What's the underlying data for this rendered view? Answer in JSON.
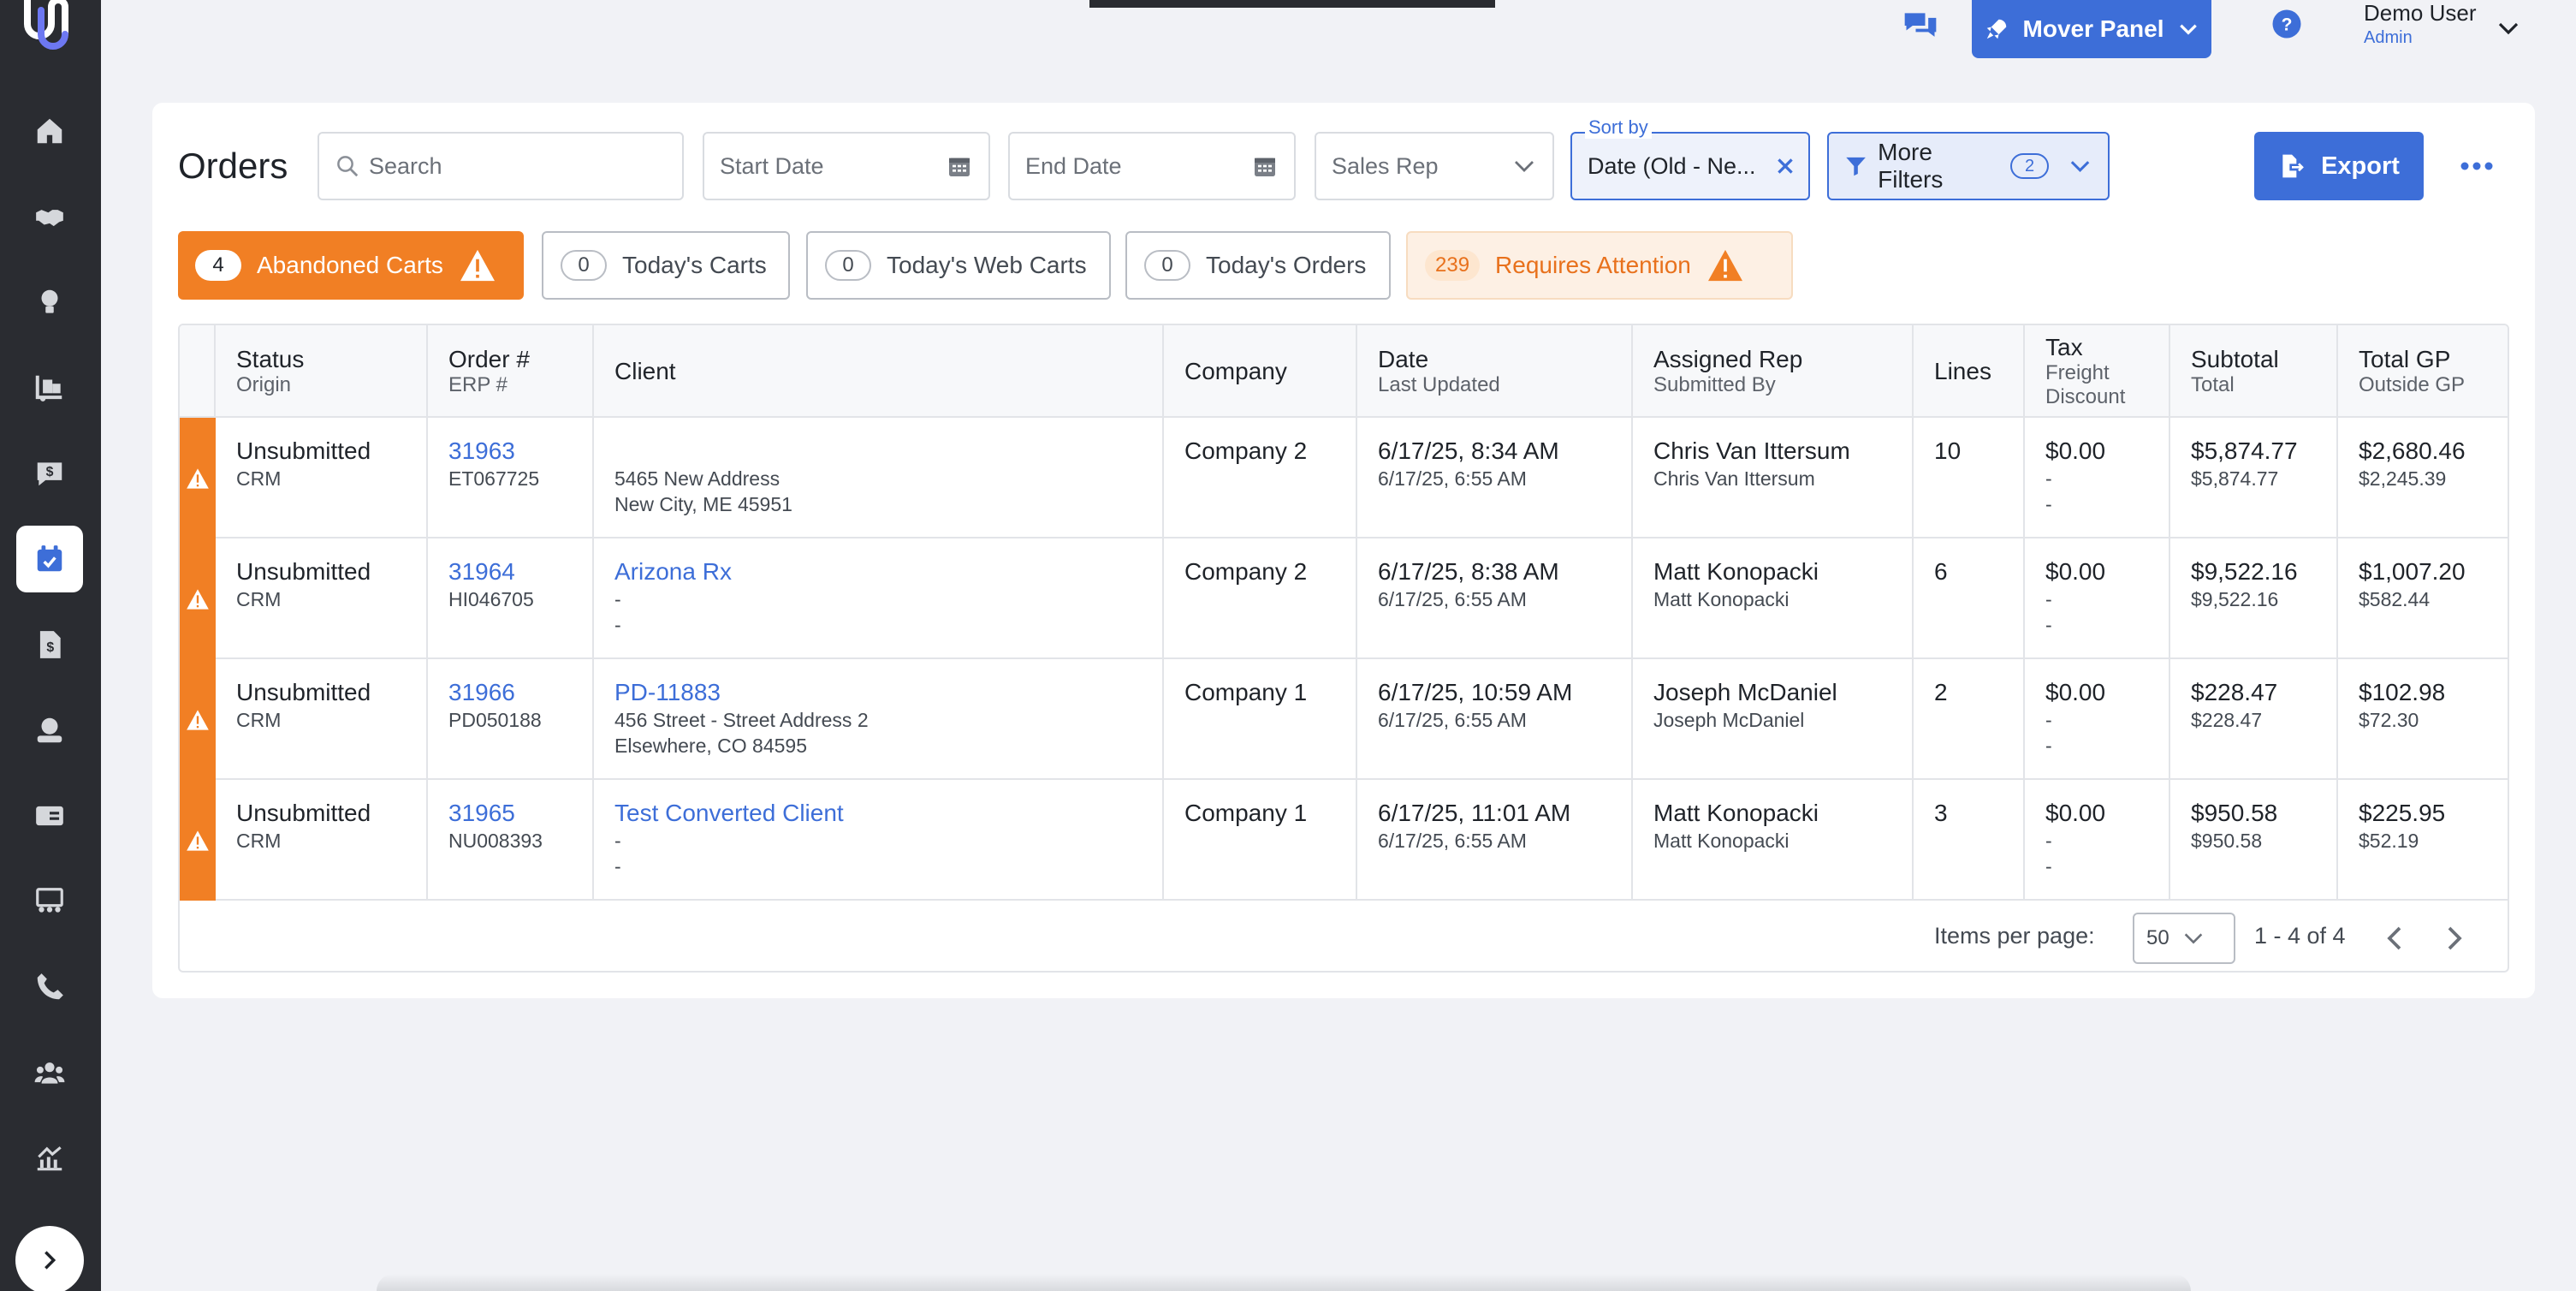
{
  "app": {
    "mover_panel_label": "Mover Panel",
    "user_name": "Demo User",
    "user_role": "Admin"
  },
  "colors": {
    "sidebar": "#2a2c31",
    "accent": "#3d6ed8",
    "warning": "#f17f24"
  },
  "icons": {
    "sidebar": [
      "home-icon",
      "handshake-icon",
      "lightbulb-icon",
      "truck-dolly-icon",
      "money-message-icon",
      "calendar-check-icon",
      "invoice-icon",
      "money-hand-icon",
      "money-card-icon",
      "team-board-icon",
      "phone-icon",
      "users-icon",
      "analytics-icon"
    ]
  },
  "toolbar": {
    "title": "Orders",
    "search_placeholder": "Search",
    "start_date_placeholder": "Start Date",
    "end_date_placeholder": "End Date",
    "sales_rep_placeholder": "Sales Rep",
    "sort_label": "Sort by",
    "sort_value": "Date (Old - Ne...",
    "more_filters_label": "More Filters",
    "more_filters_count": "2",
    "export_label": "Export"
  },
  "chips": [
    {
      "count": "4",
      "label": "Abandoned Carts"
    },
    {
      "count": "0",
      "label": "Today's Carts"
    },
    {
      "count": "0",
      "label": "Today's Web Carts"
    },
    {
      "count": "0",
      "label": "Today's Orders"
    },
    {
      "count": "239",
      "label": "Requires Attention"
    }
  ],
  "table": {
    "headers": [
      {
        "main": "Status",
        "sub": "Origin"
      },
      {
        "main": "Order #",
        "sub": "ERP #"
      },
      {
        "main": "Client",
        "sub": ""
      },
      {
        "main": "Company",
        "sub": ""
      },
      {
        "main": "Date",
        "sub": "Last Updated"
      },
      {
        "main": "Assigned Rep",
        "sub": "Submitted By"
      },
      {
        "main": "Lines",
        "sub": ""
      },
      {
        "main": "Tax",
        "sub": "Freight",
        "sub2": "Discount"
      },
      {
        "main": "Subtotal",
        "sub": "Total"
      },
      {
        "main": "Total GP",
        "sub": "Outside GP"
      }
    ],
    "rows": [
      {
        "status": "Unsubmitted",
        "origin": "CRM",
        "order": "31963",
        "erp": "ET067725",
        "client": "",
        "client_l2": "5465 New Address",
        "client_l3": "New City, ME 45951",
        "company": "Company 2",
        "date": "6/17/25, 8:34 AM",
        "updated": "6/17/25, 6:55 AM",
        "rep": "Chris Van Ittersum",
        "submitted_by": "Chris Van Ittersum",
        "lines": "10",
        "tax": "$0.00",
        "freight": "-",
        "discount": "-",
        "subtotal": "$5,874.77",
        "total": "$5,874.77",
        "gp": "$2,680.46",
        "outside_gp": "$2,245.39"
      },
      {
        "status": "Unsubmitted",
        "origin": "CRM",
        "order": "31964",
        "erp": "HI046705",
        "client": "Arizona Rx",
        "client_l2": "-",
        "client_l3": "-",
        "company": "Company 2",
        "date": "6/17/25, 8:38 AM",
        "updated": "6/17/25, 6:55 AM",
        "rep": "Matt Konopacki",
        "submitted_by": "Matt Konopacki",
        "lines": "6",
        "tax": "$0.00",
        "freight": "-",
        "discount": "-",
        "subtotal": "$9,522.16",
        "total": "$9,522.16",
        "gp": "$1,007.20",
        "outside_gp": "$582.44"
      },
      {
        "status": "Unsubmitted",
        "origin": "CRM",
        "order": "31966",
        "erp": "PD050188",
        "client": "PD-11883",
        "client_l2": "456 Street - Street Address 2",
        "client_l3": "Elsewhere, CO 84595",
        "company": "Company 1",
        "date": "6/17/25, 10:59 AM",
        "updated": "6/17/25, 6:55 AM",
        "rep": "Joseph McDaniel",
        "submitted_by": "Joseph McDaniel",
        "lines": "2",
        "tax": "$0.00",
        "freight": "-",
        "discount": "-",
        "subtotal": "$228.47",
        "total": "$228.47",
        "gp": "$102.98",
        "outside_gp": "$72.30"
      },
      {
        "status": "Unsubmitted",
        "origin": "CRM",
        "order": "31965",
        "erp": "NU008393",
        "client": "Test Converted Client",
        "client_l2": "-",
        "client_l3": "-",
        "company": "Company 1",
        "date": "6/17/25, 11:01 AM",
        "updated": "6/17/25, 6:55 AM",
        "rep": "Matt Konopacki",
        "submitted_by": "Matt Konopacki",
        "lines": "3",
        "tax": "$0.00",
        "freight": "-",
        "discount": "-",
        "subtotal": "$950.58",
        "total": "$950.58",
        "gp": "$225.95",
        "outside_gp": "$52.19"
      }
    ]
  },
  "pagination": {
    "items_per_page_label": "Items per page:",
    "items_per_page": "50",
    "range": "1 - 4 of 4"
  }
}
